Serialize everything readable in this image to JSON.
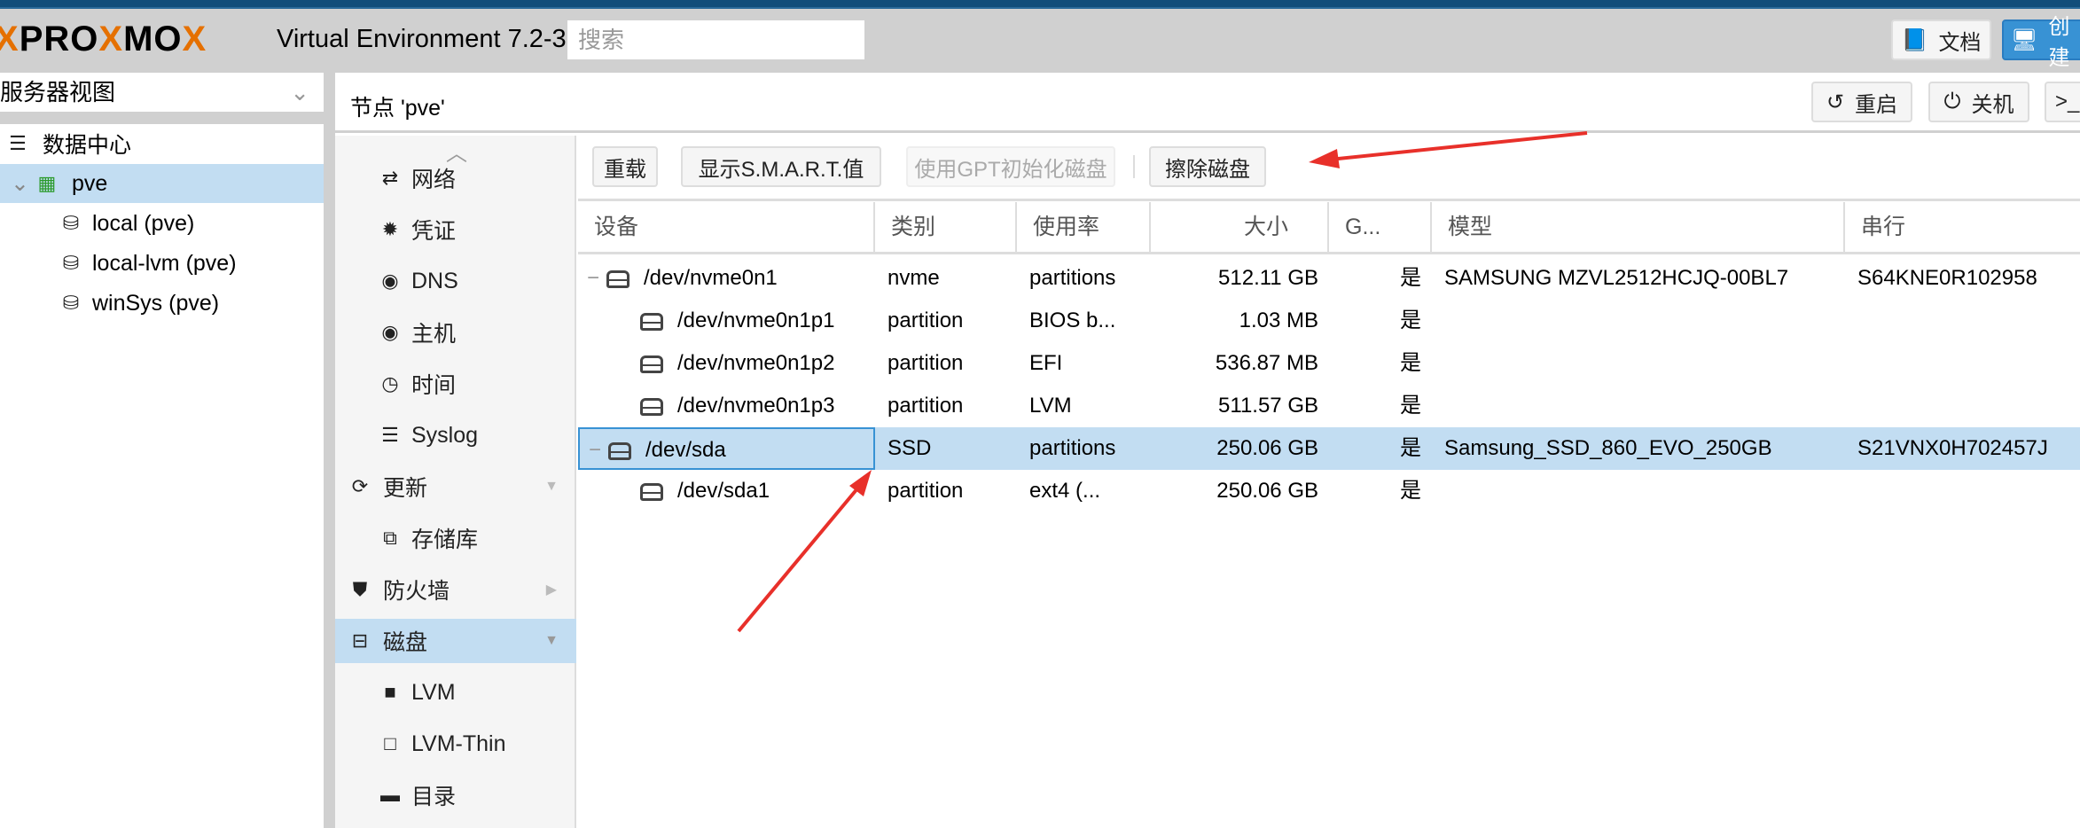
{
  "header": {
    "logo": "PROXMOX",
    "version": "Virtual Environment 7.2-3",
    "search_placeholder": "搜索",
    "docs": "文档",
    "create": "创建"
  },
  "sidebar": {
    "view": "服务器视图",
    "tree": [
      "数据中心",
      "pve",
      "local (pve)",
      "local-lvm (pve)",
      "winSys (pve)"
    ]
  },
  "node": {
    "title": "节点 'pve'",
    "reboot": "重启",
    "shutdown": "关机",
    "shell": ">_"
  },
  "nav": [
    "网络",
    "凭证",
    "DNS",
    "主机",
    "时间",
    "Syslog",
    "更新",
    "存储库",
    "防火墙",
    "磁盘",
    "LVM",
    "LVM-Thin",
    "目录"
  ],
  "toolbar": {
    "reload": "重载",
    "smart": "显示S.M.A.R.T.值",
    "gpt": "使用GPT初始化磁盘",
    "wipe": "擦除磁盘"
  },
  "table": {
    "headers": [
      "设备",
      "类别",
      "使用率",
      "大小",
      "G...",
      "模型",
      "串行"
    ],
    "rows": [
      [
        "/dev/nvme0n1",
        "nvme",
        "partitions",
        "512.11 GB",
        "是",
        "SAMSUNG MZVL2512HCJQ-00BL7",
        "S64KNE0R102958"
      ],
      [
        "/dev/nvme0n1p1",
        "partition",
        "BIOS b...",
        "1.03 MB",
        "是",
        "",
        ""
      ],
      [
        "/dev/nvme0n1p2",
        "partition",
        "EFI",
        "536.87 MB",
        "是",
        "",
        ""
      ],
      [
        "/dev/nvme0n1p3",
        "partition",
        "LVM",
        "511.57 GB",
        "是",
        "",
        ""
      ],
      [
        "/dev/sda",
        "SSD",
        "partitions",
        "250.06 GB",
        "是",
        "Samsung_SSD_860_EVO_250GB",
        "S21VNX0H702457J"
      ],
      [
        "/dev/sda1",
        "partition",
        "ext4 (...",
        "250.06 GB",
        "是",
        "",
        ""
      ]
    ]
  },
  "colors": {
    "accent": "#3892d4",
    "selected": "#c2ddf2",
    "topbar": "#114d7a",
    "arrow": "#e8302a"
  }
}
